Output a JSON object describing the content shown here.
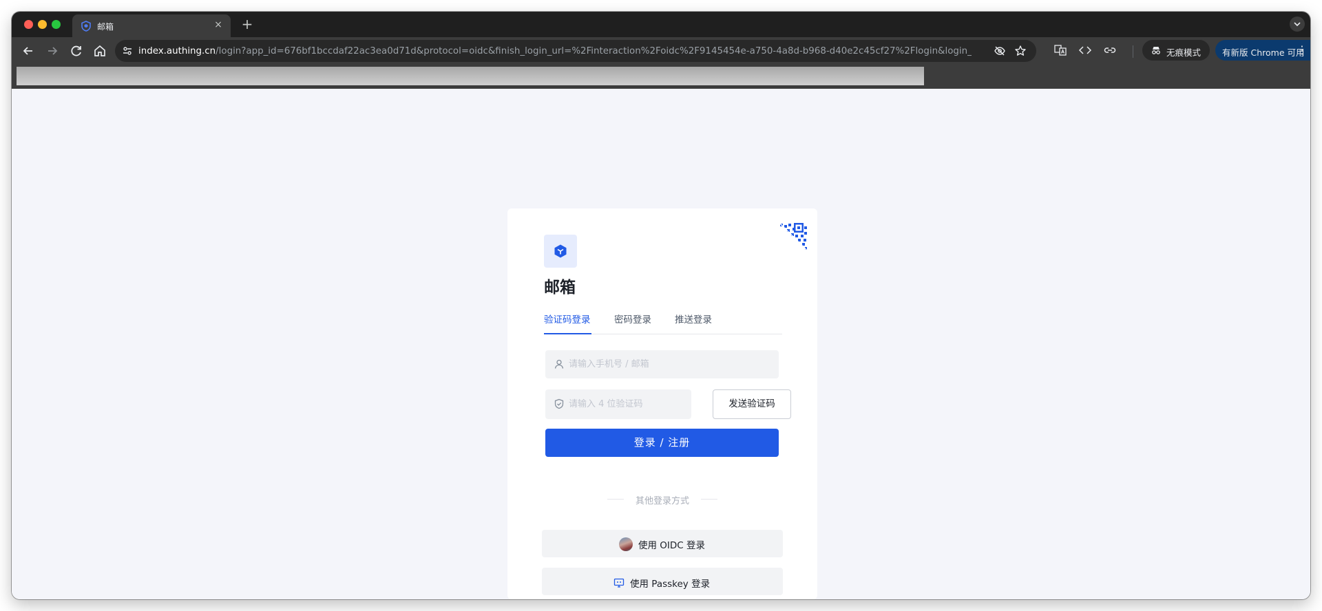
{
  "browser": {
    "tab_title": "邮箱",
    "tab_close": "×",
    "new_tab": "+",
    "url_host": "index.authing.cn",
    "url_path": "/login?app_id=676bf1bccdaf22ac3ea0d71d&protocol=oidc&finish_login_url=%2Finteraction%2Foidc%2F9145454e-a750-4a8d-b968-d40e2c45cf27%2Flogin&login_pa...",
    "incognito_label": "无痕模式",
    "update_label": "有新版 Chrome 可用",
    "menu_glyph": "⋮"
  },
  "login": {
    "app_name": "邮箱",
    "tabs": [
      {
        "label": "验证码登录"
      },
      {
        "label": "密码登录"
      },
      {
        "label": "推送登录"
      }
    ],
    "account_placeholder": "请输入手机号 / 邮箱",
    "code_placeholder": "请输入 4 位验证码",
    "send_code_label": "发送验证码",
    "submit_label": "登录 / 注册",
    "divider_text": "其他登录方式",
    "oidc_label": "使用 OIDC 登录",
    "passkey_label": "使用 Passkey 登录"
  },
  "colors": {
    "primary": "#215ae5",
    "tab_inactive": "#4e5969"
  }
}
